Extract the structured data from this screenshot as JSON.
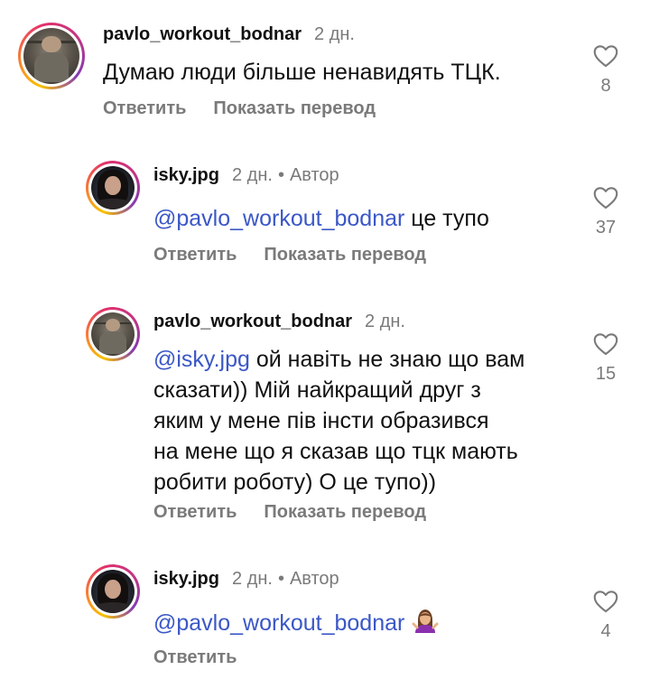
{
  "comments": [
    {
      "username": "pavlo_workout_bodnar",
      "time": "2 дн.",
      "text": "Думаю люди більше ненавидять ТЦК.",
      "reply_label": "Ответить",
      "translate_label": "Показать перевод",
      "likes": "8",
      "avatar": "gym-photo-avatar"
    },
    {
      "username": "isky.jpg",
      "time": "2 дн.",
      "author_badge": "Автор",
      "mention": "@pavlo_workout_bodnar",
      "text": " це тупо",
      "reply_label": "Ответить",
      "translate_label": "Показать перевод",
      "likes": "37",
      "avatar": "woman-portrait-avatar"
    },
    {
      "username": "pavlo_workout_bodnar",
      "time": "2 дн.",
      "mention": "@isky.jpg",
      "text_lines": [
        " ой навіть не знаю що вам",
        "сказати)) Мій найкращий друг з",
        "яким у мене пів інсти образився",
        "на мене що я сказав що тцк мають",
        "робити роботу) О це тупо))"
      ],
      "reply_label": "Ответить",
      "translate_label": "Показать перевод",
      "likes": "15",
      "avatar": "gym-photo-avatar"
    },
    {
      "username": "isky.jpg",
      "time": "2 дн.",
      "author_badge": "Автор",
      "mention": "@pavlo_workout_bodnar",
      "emoji": "woman-shrugging-emoji",
      "reply_label": "Ответить",
      "likes": "4",
      "avatar": "woman-portrait-avatar"
    }
  ],
  "separator": "•",
  "colors": {
    "mention": "#3b57c6",
    "secondary_text": "#7a7a7a",
    "primary_text": "#111111"
  }
}
